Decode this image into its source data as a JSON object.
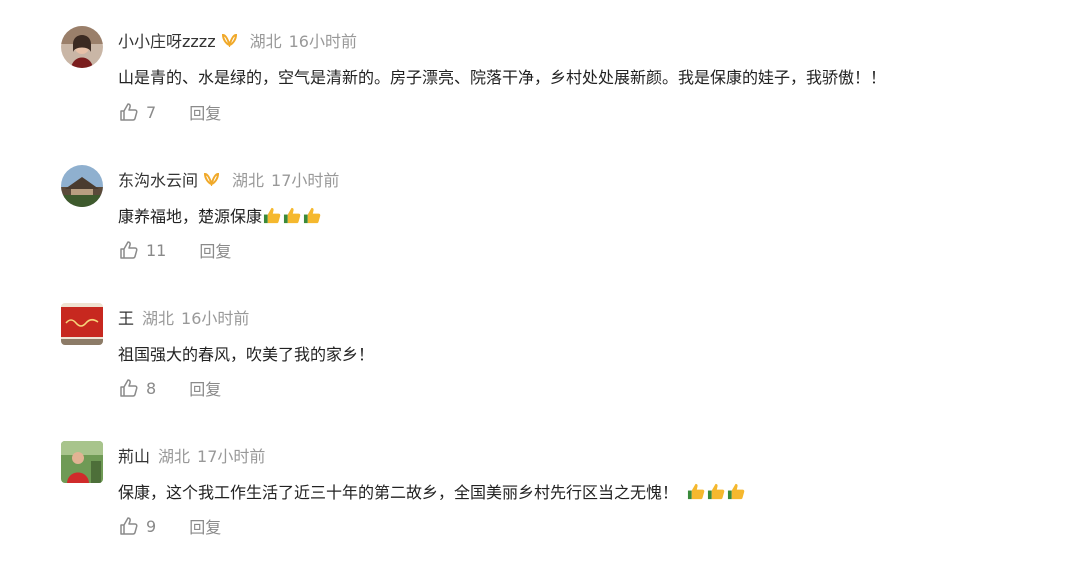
{
  "comments": [
    {
      "username": "小小庄呀zzzz",
      "location": "湖北",
      "time": "16小时前",
      "text": "山是青的、水是绿的，空气是清新的。房子漂亮、院落干净，乡村处处展新颜。我是保康的娃子，我骄傲！！",
      "likes": "7",
      "reply_label": "回复"
    },
    {
      "username": "东沟水云间",
      "location": "湖北",
      "time": "17小时前",
      "text": "康养福地，楚源保康",
      "likes": "11",
      "reply_label": "回复"
    },
    {
      "username": "王",
      "location": "湖北",
      "time": "16小时前",
      "text": "祖国强大的春风，吹美了我的家乡！",
      "likes": "8",
      "reply_label": "回复"
    },
    {
      "username": "荊山",
      "location": "湖北",
      "time": "17小时前",
      "text": "保康，这个我工作生活了近三十年的第二故乡，全国美丽乡村先行区当之无愧！",
      "likes": "9",
      "reply_label": "回复"
    }
  ],
  "icons": {
    "badge": "gold-ribbon-badge-icon",
    "like": "thumbs-up-outline-icon",
    "emoji": "thumbs-up-emoji-icon"
  },
  "colors": {
    "username": "#333333",
    "meta": "#999999",
    "text": "#222222",
    "action": "#8a8a8a",
    "badge": "#f0a92a"
  }
}
